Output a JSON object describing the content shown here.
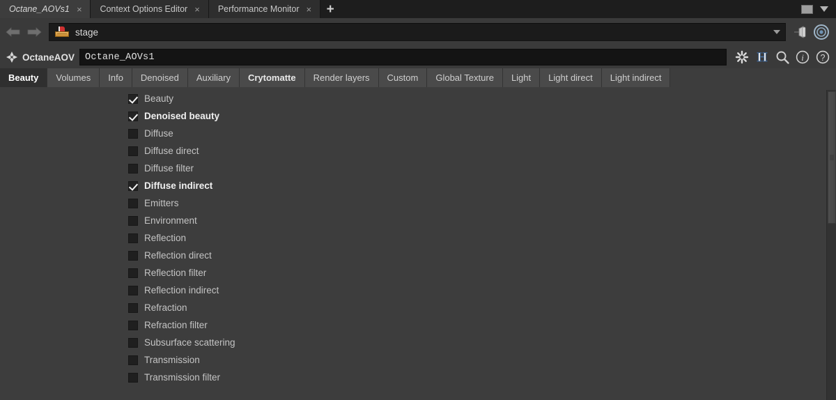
{
  "window": {
    "tabs": [
      {
        "label": "Octane_AOVs1",
        "active": true,
        "close": "×"
      },
      {
        "label": "Context Options Editor",
        "active": false,
        "close": "×"
      },
      {
        "label": "Performance Monitor",
        "active": false,
        "close": "×"
      }
    ],
    "add_tab_label": "+",
    "controls": {
      "restore_icon": "restore-window-icon",
      "menu_icon": "window-menu-chevron-icon"
    }
  },
  "toolbar": {
    "back_icon": "back-arrow-icon",
    "forward_icon": "forward-arrow-icon",
    "path_icon": "stage-node-icon",
    "path_value": "stage",
    "path_placeholder": "stage",
    "path_dropdown_icon": "chevron-down-icon",
    "pin_icon": "pin-icon",
    "target_icon": "target-icon"
  },
  "node_header": {
    "type_icon": "octane-node-icon",
    "type_label": "OctaneAOV",
    "node_name": "Octane_AOVs1",
    "icons": [
      {
        "name": "gear-icon",
        "glyph": "✸"
      },
      {
        "name": "houdini-h-icon",
        "glyph": "H"
      },
      {
        "name": "search-icon",
        "glyph": "search"
      },
      {
        "name": "info-icon",
        "glyph": "i"
      },
      {
        "name": "help-icon",
        "glyph": "?"
      }
    ]
  },
  "parameter_tabs": [
    {
      "label": "Beauty",
      "active": true,
      "bold": true
    },
    {
      "label": "Volumes",
      "active": false,
      "bold": false
    },
    {
      "label": "Info",
      "active": false,
      "bold": false
    },
    {
      "label": "Denoised",
      "active": false,
      "bold": false
    },
    {
      "label": "Auxiliary",
      "active": false,
      "bold": false
    },
    {
      "label": "Crytomatte",
      "active": false,
      "bold": true
    },
    {
      "label": "Render layers",
      "active": false,
      "bold": false
    },
    {
      "label": "Custom",
      "active": false,
      "bold": false
    },
    {
      "label": "Global Texture",
      "active": false,
      "bold": false
    },
    {
      "label": "Light",
      "active": false,
      "bold": false
    },
    {
      "label": "Light direct",
      "active": false,
      "bold": false
    },
    {
      "label": "Light indirect",
      "active": false,
      "bold": false
    }
  ],
  "aov_list": [
    {
      "label": "Beauty",
      "checked": true,
      "bold": false
    },
    {
      "label": "Denoised beauty",
      "checked": true,
      "bold": true
    },
    {
      "label": "Diffuse",
      "checked": false,
      "bold": false
    },
    {
      "label": "Diffuse direct",
      "checked": false,
      "bold": false
    },
    {
      "label": "Diffuse filter",
      "checked": false,
      "bold": false
    },
    {
      "label": "Diffuse indirect",
      "checked": true,
      "bold": true
    },
    {
      "label": "Emitters",
      "checked": false,
      "bold": false
    },
    {
      "label": "Environment",
      "checked": false,
      "bold": false
    },
    {
      "label": "Reflection",
      "checked": false,
      "bold": false
    },
    {
      "label": "Reflection direct",
      "checked": false,
      "bold": false
    },
    {
      "label": "Reflection filter",
      "checked": false,
      "bold": false
    },
    {
      "label": "Reflection indirect",
      "checked": false,
      "bold": false
    },
    {
      "label": "Refraction",
      "checked": false,
      "bold": false
    },
    {
      "label": "Refraction filter",
      "checked": false,
      "bold": false
    },
    {
      "label": "Subsurface scattering",
      "checked": false,
      "bold": false
    },
    {
      "label": "Transmission",
      "checked": false,
      "bold": false
    },
    {
      "label": "Transmission filter",
      "checked": false,
      "bold": false
    }
  ],
  "scrollbar": {
    "name": "vertical-scrollbar",
    "thumb_name": "scrollbar-thumb"
  },
  "colors": {
    "panel_bg": "#3d3d3d",
    "tabbar_bg": "#1d1d1d",
    "active_tab_bg": "#2f2f2f",
    "inactive_tab_bg": "#4a4a4a",
    "field_bg": "#141414",
    "text": "#c4c4c4",
    "text_bold": "#f0f0f0",
    "stage_icon": "#c98a2e"
  }
}
